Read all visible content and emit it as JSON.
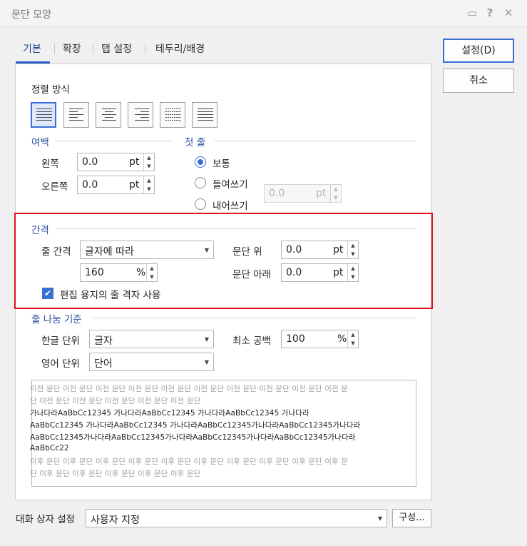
{
  "window": {
    "title": "문단 모양"
  },
  "titlebar_icons": [
    "comment-icon",
    "help-icon",
    "close-icon"
  ],
  "titlebar_glyphs": {
    "comment": "▭",
    "help": "?",
    "close": "✕"
  },
  "tabs": [
    "기본",
    "확장",
    "탭 설정",
    "테두리/배경"
  ],
  "alignment": {
    "label": "정렬 방식",
    "options": [
      "justify",
      "left",
      "center",
      "right",
      "distribute",
      "divide"
    ],
    "selected": "justify"
  },
  "margin": {
    "title": "여백",
    "left_label": "왼쪽",
    "left_value": "0.0",
    "left_unit": "pt",
    "right_label": "오른쪽",
    "right_value": "0.0",
    "right_unit": "pt"
  },
  "first_line": {
    "title": "첫 줄",
    "options": [
      "보통",
      "들여쓰기",
      "내어쓰기"
    ],
    "selected": "보통",
    "value": "0.0",
    "unit": "pt"
  },
  "spacing": {
    "title": "간격",
    "line_label": "줄 간격",
    "line_mode": "글자에 따라",
    "line_value": "160",
    "line_unit": "%",
    "above_label": "문단 위",
    "above_value": "0.0",
    "above_unit": "pt",
    "below_label": "문단 아래",
    "below_value": "0.0",
    "below_unit": "pt",
    "grid_checkbox_label": "편집 용지의 줄 격자 사용",
    "grid_checked": true
  },
  "line_break": {
    "title": "줄 나눔 기준",
    "korean_label": "한글 단위",
    "korean_value": "글자",
    "english_label": "영어 단위",
    "english_value": "단어",
    "min_space_label": "최소 공백",
    "min_space_value": "100",
    "min_space_unit": "%"
  },
  "preview": {
    "prev_lines": [
      "이전 문단 이전 문단 이전 문단 이전 문단 이전 문단 이전 문단 이전 문단 이전 문단 이전 문단 이전 문",
      "단 이전 문단 이전 문단 이전 문단 이전 문단 이전 문단"
    ],
    "sample_lines": [
      "가나다라AaBbCc12345        가나다라AaBbCc12345        가나다라AaBbCc12345        가나다라",
      "AaBbCc12345  가나다라AaBbCc12345  가나다라AaBbCc12345가나다라AaBbCc12345가나다라",
      "AaBbCc12345가나다라AaBbCc12345가나다라AaBbCc12345가나다라AaBbCc12345가나다라",
      "AaBbCc22"
    ],
    "next_lines": [
      "이후 문단 이후 문단 이후 문단 이후 문단 이후 문단 이후 문단 이후 문단 이후 문단 이후 문단 이후 문",
      "단 이후 문단 이후 문단 이후 문단 이후 문단 이후 문단"
    ]
  },
  "buttons": {
    "ok": "설정(D)",
    "cancel": "취소",
    "configure": "구성..."
  },
  "dialog_setting": {
    "label": "대화 상자 설정",
    "value": "사용자 지정"
  },
  "colors": {
    "accent": "#3b6fd4",
    "section": "#2c4fa0",
    "highlight": "#e0141e"
  }
}
